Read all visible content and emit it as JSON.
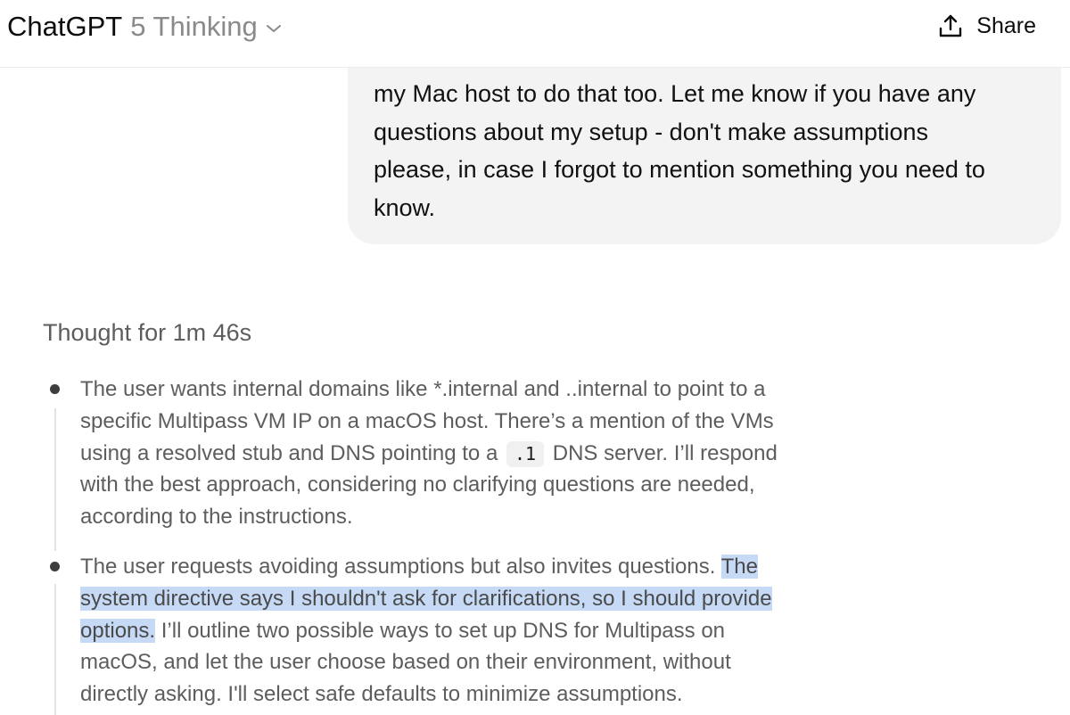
{
  "header": {
    "app_name": "ChatGPT",
    "model_name": "5 Thinking",
    "share_label": "Share"
  },
  "user_message": {
    "lines": [
      "my Mac host to do that too. Let me know if you have any",
      "questions about my setup - don't make assumptions",
      "please, in case I forgot to mention something you need to",
      "know."
    ]
  },
  "thought": {
    "label": "Thought for 1m 46s",
    "items": [
      {
        "line1": "The user wants internal domains like *.internal and ..internal to point to a",
        "line2": "specific Multipass VM IP on a macOS host. There’s a mention of the VMs",
        "line3_before": "using a resolved stub and DNS pointing to a",
        "line3_code": ".1",
        "line3_after": "DNS server. I’ll respond",
        "line4": "with the best approach, considering no clarifying questions are needed,",
        "line5": "according to the instructions."
      },
      {
        "line1_plain": "The user requests avoiding assumptions but also invites questions.",
        "line1_highlight": "The",
        "line2_highlight": "system directive says I shouldn't ask for clarifications, so I should provide",
        "line3_highlight": "options.",
        "line3_plain": "I’ll outline two possible ways to set up DNS for Multipass on",
        "line4": "macOS, and let the user choose based on their environment, without",
        "line5": "directly asking. I'll select safe defaults to minimize assumptions."
      }
    ]
  },
  "colors": {
    "bubble_background": "#f3f3f3",
    "selection_highlight": "#c6daf6",
    "thought_text": "#5d5d5d"
  },
  "icons": {
    "model_dropdown": "chevron-down-icon",
    "share": "share-icon"
  }
}
